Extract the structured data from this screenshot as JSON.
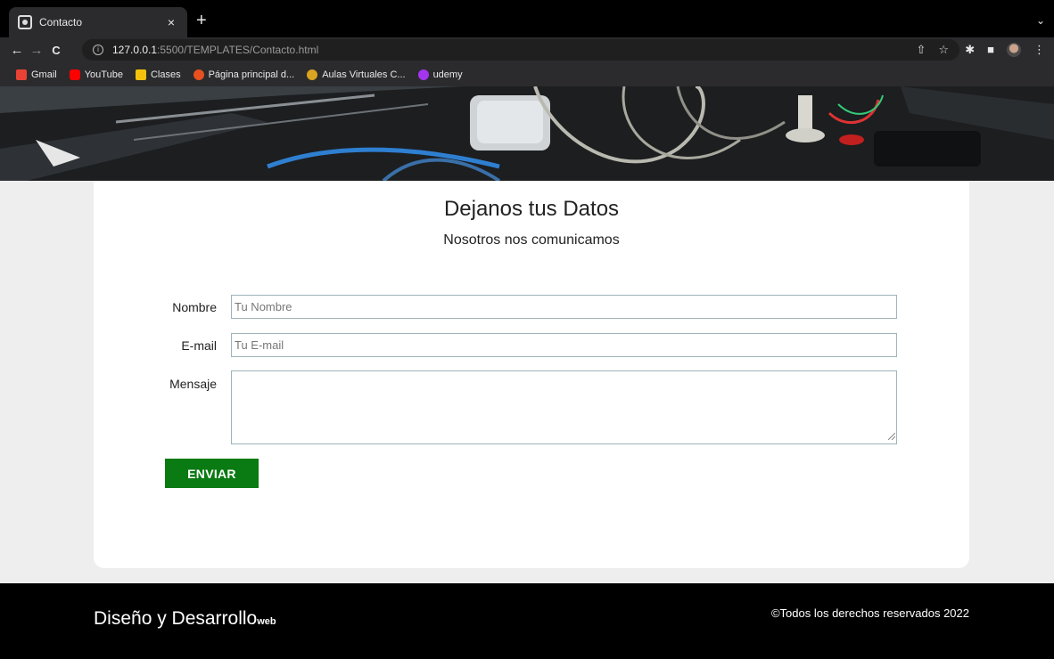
{
  "browser": {
    "tab": {
      "title": "Contacto",
      "close_glyph": "×"
    },
    "new_tab_glyph": "+",
    "tab_menu_glyph": "⌄",
    "nav": {
      "back_glyph": "←",
      "forward_glyph": "→",
      "reload_glyph": "C"
    },
    "address": {
      "host": "127.0.0.1",
      "path": ":5500/TEMPLATES/Contacto.html"
    },
    "bookmarks": [
      {
        "label": "Gmail",
        "color": "#e94235"
      },
      {
        "label": "YouTube",
        "color": "#ff0000"
      },
      {
        "label": "Clases",
        "color": "#f4c20d"
      },
      {
        "label": "Página principal d...",
        "color": "#e8501f"
      },
      {
        "label": "Aulas Virtuales C...",
        "color": "#d9a420"
      },
      {
        "label": "udemy",
        "color": "#a435f0"
      }
    ]
  },
  "page": {
    "title": "Dejanos tus Datos",
    "subtitle": "Nosotros nos comunicamos",
    "form": {
      "name_label": "Nombre",
      "name_placeholder": "Tu Nombre",
      "email_label": "E-mail",
      "email_placeholder": "Tu E-mail",
      "message_label": "Mensaje",
      "submit_label": "ENVIAR"
    },
    "footer": {
      "brand_main": "Diseño y Desarrollo",
      "brand_suffix": "web",
      "copyright": "©Todos los derechos reservados 2022"
    }
  },
  "colors": {
    "accent_button": "#0a7a12",
    "footer_bg": "#000000",
    "page_bg": "#eeeeee"
  }
}
